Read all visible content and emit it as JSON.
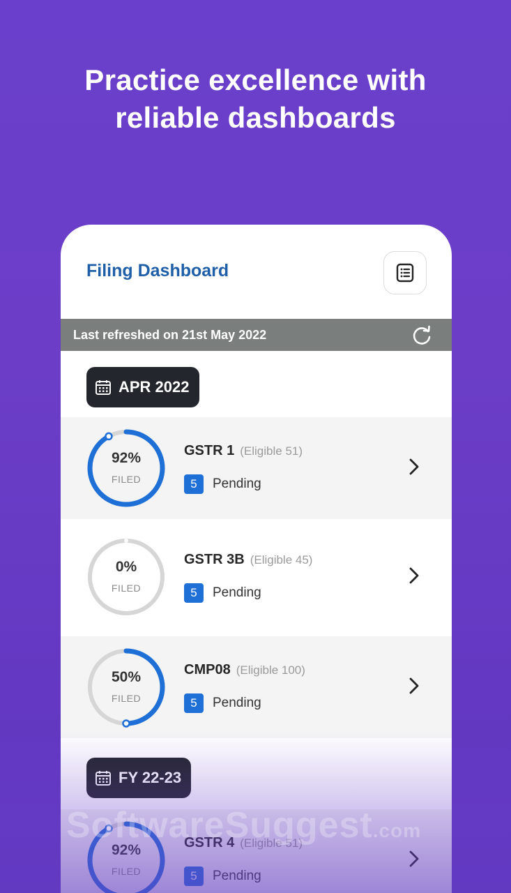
{
  "headline": {
    "line1": "Practice excellence with",
    "line2": "reliable dashboards"
  },
  "dashboard": {
    "title": "Filing Dashboard",
    "menu_icon": "list-icon",
    "refresh_text": "Last refreshed on 21st May 2022",
    "refresh_icon": "refresh-icon",
    "accent_color": "#1e6fd6",
    "groups": [
      {
        "period": "APR 2022",
        "items": [
          {
            "pct": "92%",
            "filed_label": "FILED",
            "form": "GSTR 1",
            "eligible": "(Eligible 51)",
            "pending_count": "5",
            "pending_label": "Pending",
            "progress": 0.92
          },
          {
            "pct": "0%",
            "filed_label": "FILED",
            "form": "GSTR 3B",
            "eligible": "(Eligible 45)",
            "pending_count": "5",
            "pending_label": "Pending",
            "progress": 0
          },
          {
            "pct": "50%",
            "filed_label": "FILED",
            "form": "CMP08",
            "eligible": "(Eligible 100)",
            "pending_count": "5",
            "pending_label": "Pending",
            "progress": 0.5
          }
        ]
      },
      {
        "period": "FY 22-23",
        "items": [
          {
            "pct": "92%",
            "filed_label": "FILED",
            "form": "GSTR 4",
            "eligible": "(Eligible 51)",
            "pending_count": "5",
            "pending_label": "Pending",
            "progress": 0.92
          }
        ]
      }
    ]
  },
  "watermark": {
    "text": "SoftwareSuggest",
    "suffix": ".com"
  }
}
